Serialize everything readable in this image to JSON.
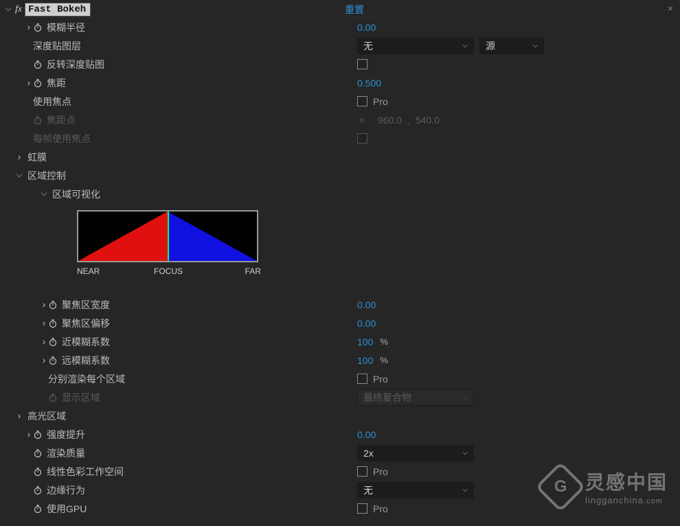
{
  "effect": {
    "name": "Fast Bokeh",
    "reset": "重置"
  },
  "props": {
    "blur_radius": {
      "label": "模糊半径",
      "value": "0.00"
    },
    "depth_layer": {
      "label": "深度贴图层",
      "layer_value": "无",
      "source_value": "源"
    },
    "invert_depth": {
      "label": "反转深度贴图"
    },
    "focal_distance": {
      "label": "焦距",
      "value": "0.500"
    },
    "use_focal_point": {
      "label": "使用焦点",
      "badge": "Pro"
    },
    "focal_point": {
      "label": "焦距点",
      "x": "960.0",
      "y": "540.0"
    },
    "use_focal_each_frame": {
      "label": "每帧使用焦点"
    },
    "iris": {
      "label": "虹膜"
    },
    "range_control": {
      "label": "区域控制"
    },
    "range_viz": {
      "label": "区域可视化",
      "near": "NEAR",
      "focus": "FOCUS",
      "far": "FAR"
    },
    "focus_width": {
      "label": "聚焦区宽度",
      "value": "0.00"
    },
    "focus_offset": {
      "label": "聚焦区偏移",
      "value": "0.00"
    },
    "near_blur_coef": {
      "label": "近模糊系数",
      "value": "100",
      "unit": "%"
    },
    "far_blur_coef": {
      "label": "远模糊系数",
      "value": "100",
      "unit": "%"
    },
    "render_each_range": {
      "label": "分别渲染每个区域",
      "badge": "Pro"
    },
    "show_range": {
      "label": "显示区域",
      "dd": "最终复合物"
    },
    "highlight_range": {
      "label": "高光区域"
    },
    "boost_intensity": {
      "label": "强度提升",
      "value": "0.00"
    },
    "render_quality": {
      "label": "渲染质量",
      "dd": "2x"
    },
    "linear_color": {
      "label": "线性色彩工作空间",
      "badge": "Pro"
    },
    "edge_behavior": {
      "label": "边缘行为",
      "dd": "无"
    },
    "use_gpu": {
      "label": "使用GPU",
      "badge": "Pro"
    }
  },
  "watermark": {
    "zh": "灵感中国",
    "en": "lingganchina",
    "tld": ".com"
  }
}
